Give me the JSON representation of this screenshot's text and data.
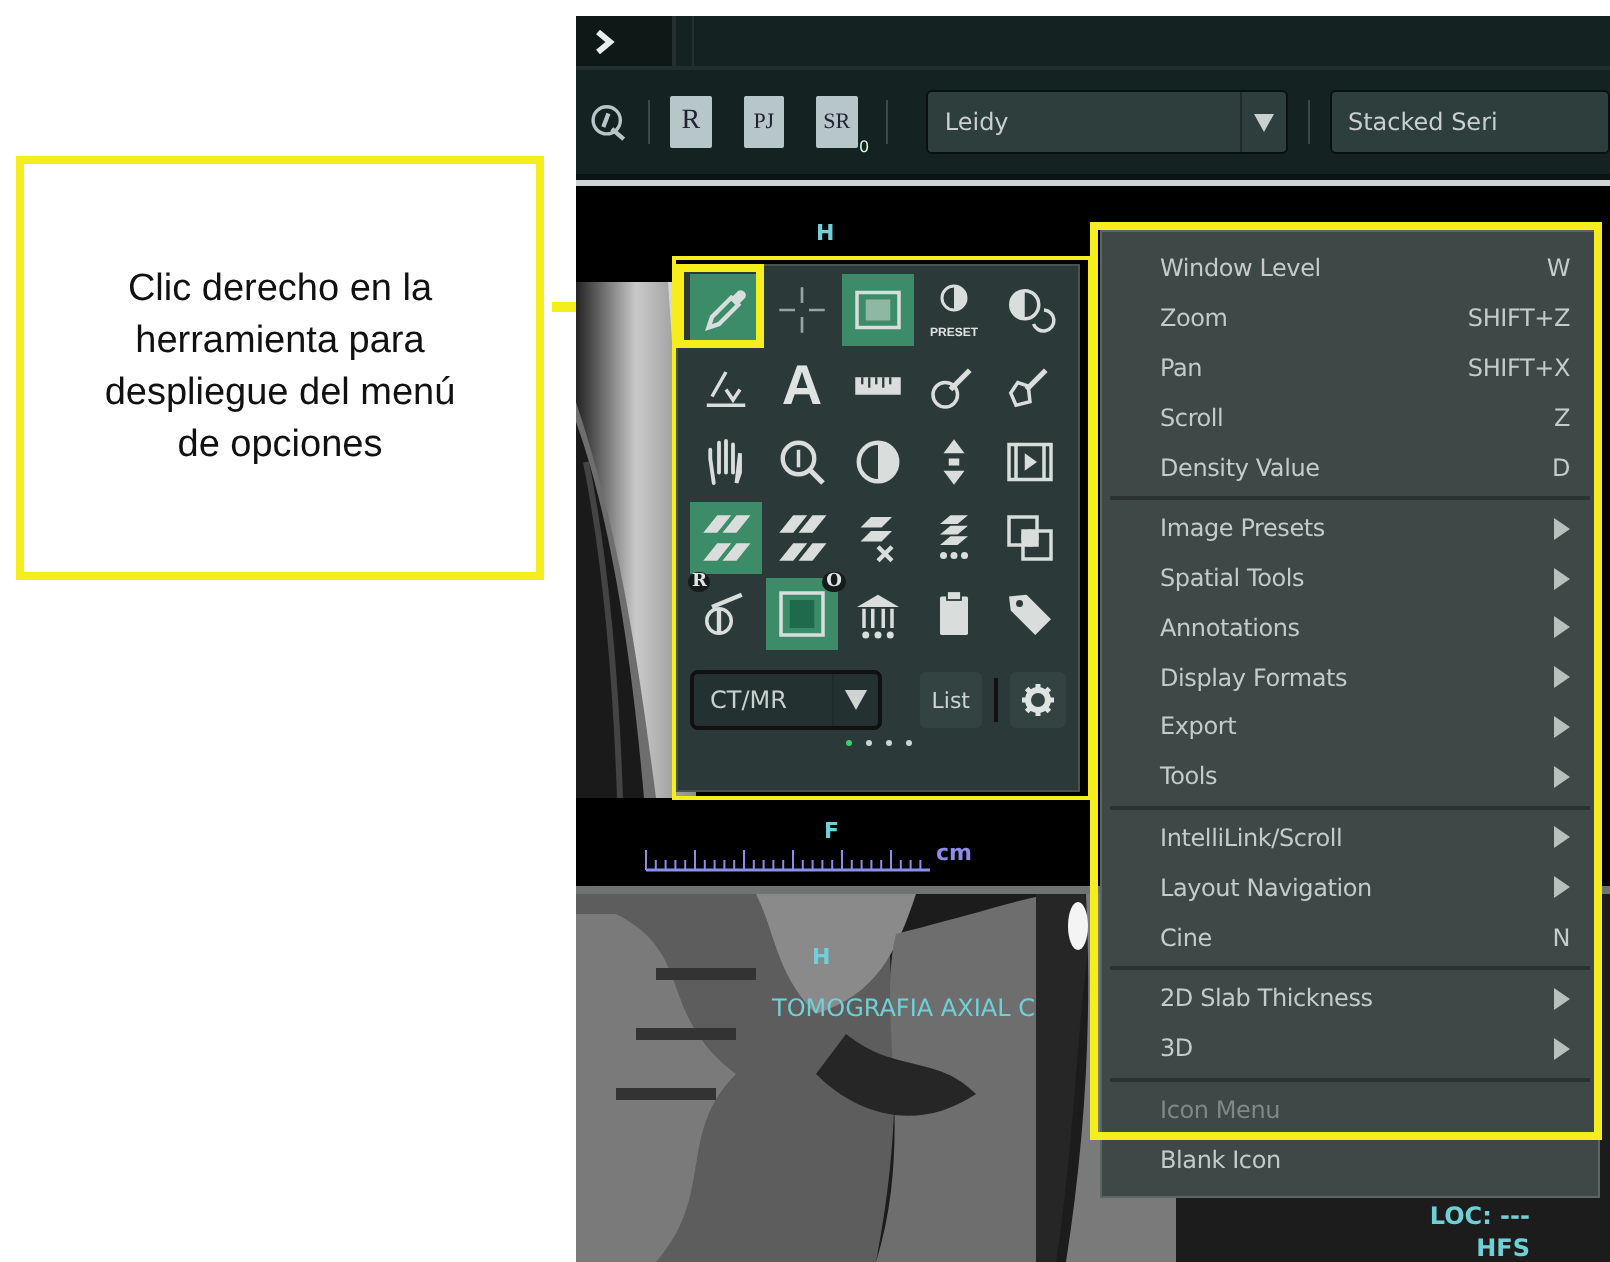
{
  "callout": {
    "text": "Clic derecho en la herramienta para despliegue del menú de opciones"
  },
  "toolbar": {
    "documents": [
      {
        "label": "R"
      },
      {
        "label": "PJ"
      },
      {
        "label": "SR",
        "sub": "0"
      }
    ],
    "user_dropdown": {
      "value": "Leidy"
    },
    "layout_dropdown": {
      "value": "Stacked Seri"
    }
  },
  "viewport_top": {
    "top_label": "H",
    "bottom_label": "F",
    "ruler_unit": "cm"
  },
  "tool_palette": {
    "tools": [
      {
        "selected": true
      },
      {
        "selected": false
      },
      {
        "selected": true
      },
      {
        "selected": false,
        "caption": "PRESET"
      },
      {
        "selected": false
      },
      {
        "selected": false
      },
      {
        "selected": false,
        "glyph": "A"
      },
      {
        "selected": false
      },
      {
        "selected": false
      },
      {
        "selected": false
      },
      {
        "selected": false
      },
      {
        "selected": false
      },
      {
        "selected": false
      },
      {
        "selected": false
      },
      {
        "selected": false
      },
      {
        "selected": true,
        "badge": "R"
      },
      {
        "selected": false,
        "badge": "O"
      },
      {
        "selected": false
      },
      {
        "selected": false
      },
      {
        "selected": false
      },
      {
        "selected": false
      },
      {
        "selected": true
      },
      {
        "selected": false
      },
      {
        "selected": false
      },
      {
        "selected": false
      }
    ],
    "preset_dropdown": {
      "value": "CT/MR"
    },
    "list_button": "List",
    "pages": [
      {
        "selected": true
      },
      {
        "selected": false
      },
      {
        "selected": false
      },
      {
        "selected": false
      }
    ]
  },
  "context_menu": {
    "groups": [
      [
        {
          "kind": "command",
          "label": "Window Level",
          "shortcut": "W",
          "disabled": false
        },
        {
          "kind": "command",
          "label": "Zoom",
          "shortcut": "SHIFT+Z",
          "disabled": false
        },
        {
          "kind": "command",
          "label": "Pan",
          "shortcut": "SHIFT+X",
          "disabled": false
        },
        {
          "kind": "command",
          "label": "Scroll",
          "shortcut": "Z",
          "disabled": false
        },
        {
          "kind": "command",
          "label": "Density Value",
          "shortcut": "D",
          "disabled": false
        }
      ],
      [
        {
          "kind": "submenu",
          "label": "Image Presets",
          "disabled": false
        },
        {
          "kind": "submenu",
          "label": "Spatial Tools",
          "disabled": false
        },
        {
          "kind": "submenu",
          "label": "Annotations",
          "disabled": false
        },
        {
          "kind": "submenu",
          "label": "Display Formats",
          "disabled": false
        },
        {
          "kind": "submenu",
          "label": "Export",
          "disabled": false
        },
        {
          "kind": "submenu",
          "label": "Tools",
          "disabled": false
        }
      ],
      [
        {
          "kind": "submenu",
          "label": "IntelliLink/Scroll",
          "disabled": false
        },
        {
          "kind": "submenu",
          "label": "Layout Navigation",
          "disabled": false
        },
        {
          "kind": "command",
          "label": "Cine",
          "shortcut": "N",
          "disabled": false
        }
      ],
      [
        {
          "kind": "submenu",
          "label": "2D Slab Thickness",
          "disabled": false
        },
        {
          "kind": "submenu",
          "label": "3D",
          "disabled": false
        }
      ],
      [
        {
          "kind": "command",
          "label": "Icon Menu",
          "disabled": true
        },
        {
          "kind": "command",
          "label": "Blank Icon",
          "disabled": false
        }
      ]
    ]
  },
  "viewport_bottom": {
    "top_label": "H",
    "series_label": "TOMOGRAFIA AXIAL C",
    "location": "LOC: ---",
    "orientation": "HFS"
  }
}
